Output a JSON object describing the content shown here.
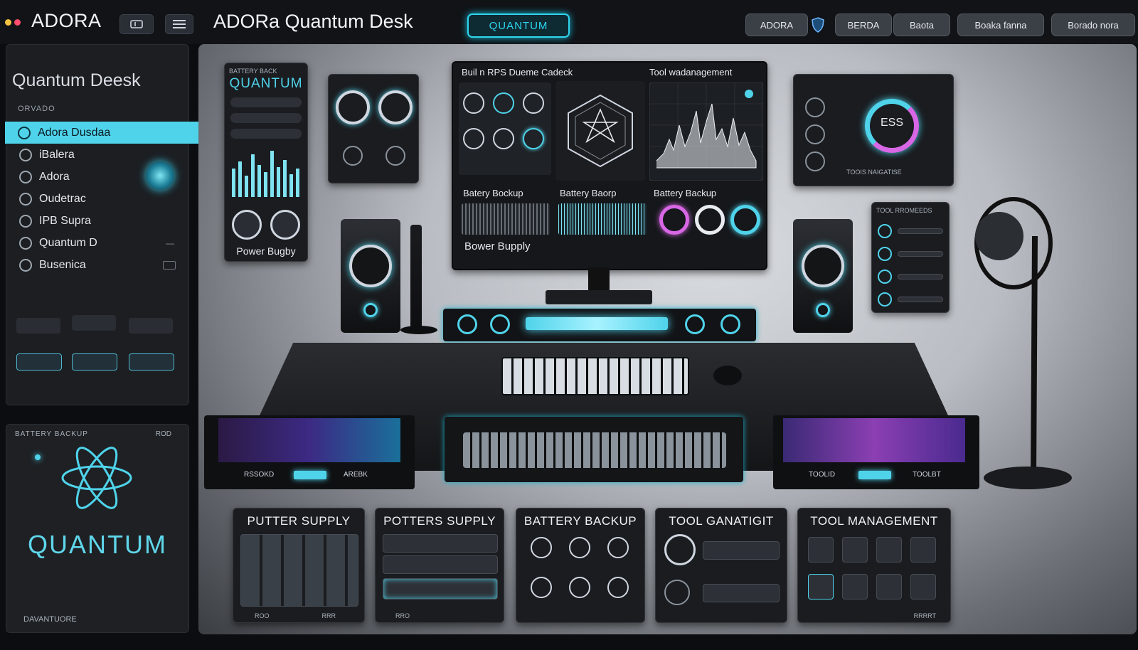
{
  "topbar": {
    "brand": "ADORA",
    "title": "ADORa Quantum Desk",
    "quantum_pill": "QUANTUM",
    "pills": [
      "ADORA",
      "BERDA",
      "Baota",
      "Boaka fanna",
      "Borado nora"
    ],
    "window_dots": [
      "#f5c542",
      "#ff4d6d"
    ],
    "accent": "#2fd5ee"
  },
  "sidebar": {
    "title": "Quantum Deesk",
    "section": "ORVADO",
    "items": [
      {
        "label": "Adora Dusdaa",
        "icon": "orb-icon",
        "active": true
      },
      {
        "label": "iBalera",
        "icon": "orb-icon"
      },
      {
        "label": "Adora",
        "icon": "orb-icon"
      },
      {
        "label": "Oudetrac",
        "icon": "orb-icon"
      },
      {
        "label": "IPB Supra",
        "icon": "orb-icon"
      },
      {
        "label": "Quantum D",
        "icon": "orb-icon"
      },
      {
        "label": "Busenica",
        "icon": "orb-icon"
      }
    ]
  },
  "quantum_panel": {
    "header_left": "BATTERY BACKUP",
    "header_right": "ROD",
    "label": "QUANTUM",
    "footer": "DAVANTUORE"
  },
  "monitor": {
    "header_left": "Buil n RPS  Dueme Cadeck",
    "header_right": "Tool   wadanagement",
    "panel_labels": [
      "Batery Bockup",
      "Battery Baorp",
      "Battery Backup"
    ],
    "footer_label": "Bower Bupply"
  },
  "left_panel": {
    "header": "BATTERY BACK",
    "title": "QUANTUM",
    "footer": "Power Bugby"
  },
  "ess_panel": {
    "label": "ESS",
    "footer": "TOOIS  NAIGATISE"
  },
  "tool_panel": {
    "header": "TOOL RROMEEDS"
  },
  "drawers": {
    "left": [
      "RSSOKD",
      "AREBK"
    ],
    "right": [
      "TOOLID",
      "TOOLBT"
    ]
  },
  "bottom_cards": [
    {
      "label": "PUTTER SUPPLY",
      "footer_left": "ROO",
      "footer_right": "RRR"
    },
    {
      "label": "POTTERS SUPPLY",
      "footer_left": "RRO",
      "footer_right": ""
    },
    {
      "label": "BATTERY BACKUP",
      "footer_left": "",
      "footer_right": ""
    },
    {
      "label": "TOOL GANATIGIT",
      "footer_left": "",
      "footer_right": ""
    },
    {
      "label": "TOOL MANAGEMENT",
      "footer_left": "",
      "footer_right": "RRRRT"
    }
  ]
}
